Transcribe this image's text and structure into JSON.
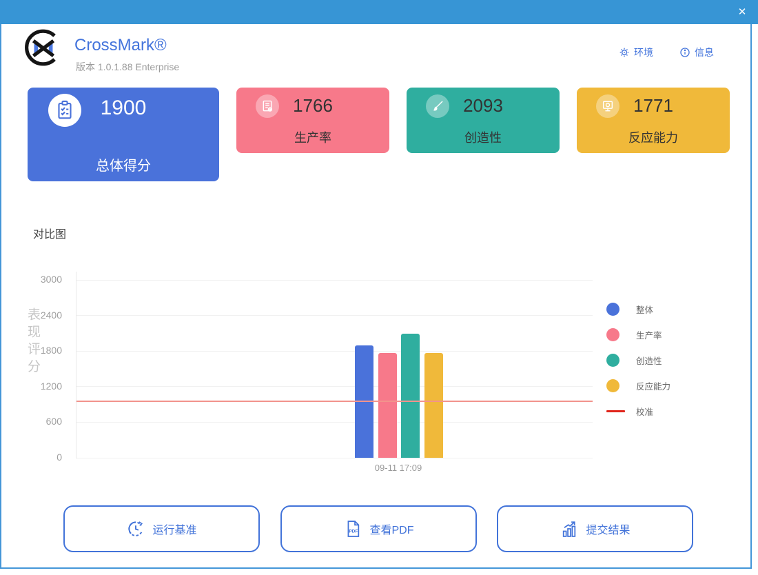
{
  "window": {
    "close": "✕"
  },
  "header": {
    "title": "CrossMark®",
    "subtitle": "版本 1.0.1.88 Enterprise",
    "env_label": "环境",
    "info_label": "信息"
  },
  "cards": [
    {
      "value": "1900",
      "label": "总体得分",
      "color": "#4a72da"
    },
    {
      "value": "1766",
      "label": "生产率",
      "color": "#f7798a"
    },
    {
      "value": "2093",
      "label": "创造性",
      "color": "#2fae9f"
    },
    {
      "value": "1771",
      "label": "反应能力",
      "color": "#f0b93a"
    }
  ],
  "chart_data": {
    "type": "bar",
    "title": "对比图",
    "ylabel": "表现评分",
    "categories": [
      "09-11 17:09"
    ],
    "series": [
      {
        "name": "整体",
        "values": [
          1900
        ],
        "color": "#4a72da"
      },
      {
        "name": "生产率",
        "values": [
          1766
        ],
        "color": "#f7798a"
      },
      {
        "name": "创造性",
        "values": [
          2093
        ],
        "color": "#2fae9f"
      },
      {
        "name": "反应能力",
        "values": [
          1771
        ],
        "color": "#f0b93a"
      }
    ],
    "reference_line": {
      "name": "校准",
      "value": 950,
      "color": "#f2938c",
      "legend_color": "#e0251b"
    },
    "ylim": [
      0,
      3000
    ],
    "yticks": [
      0,
      600,
      1200,
      1800,
      2400,
      3000
    ],
    "grid": true,
    "legend_position": "right"
  },
  "buttons": [
    {
      "label": "运行基准"
    },
    {
      "label": "查看PDF"
    },
    {
      "label": "提交结果"
    }
  ]
}
